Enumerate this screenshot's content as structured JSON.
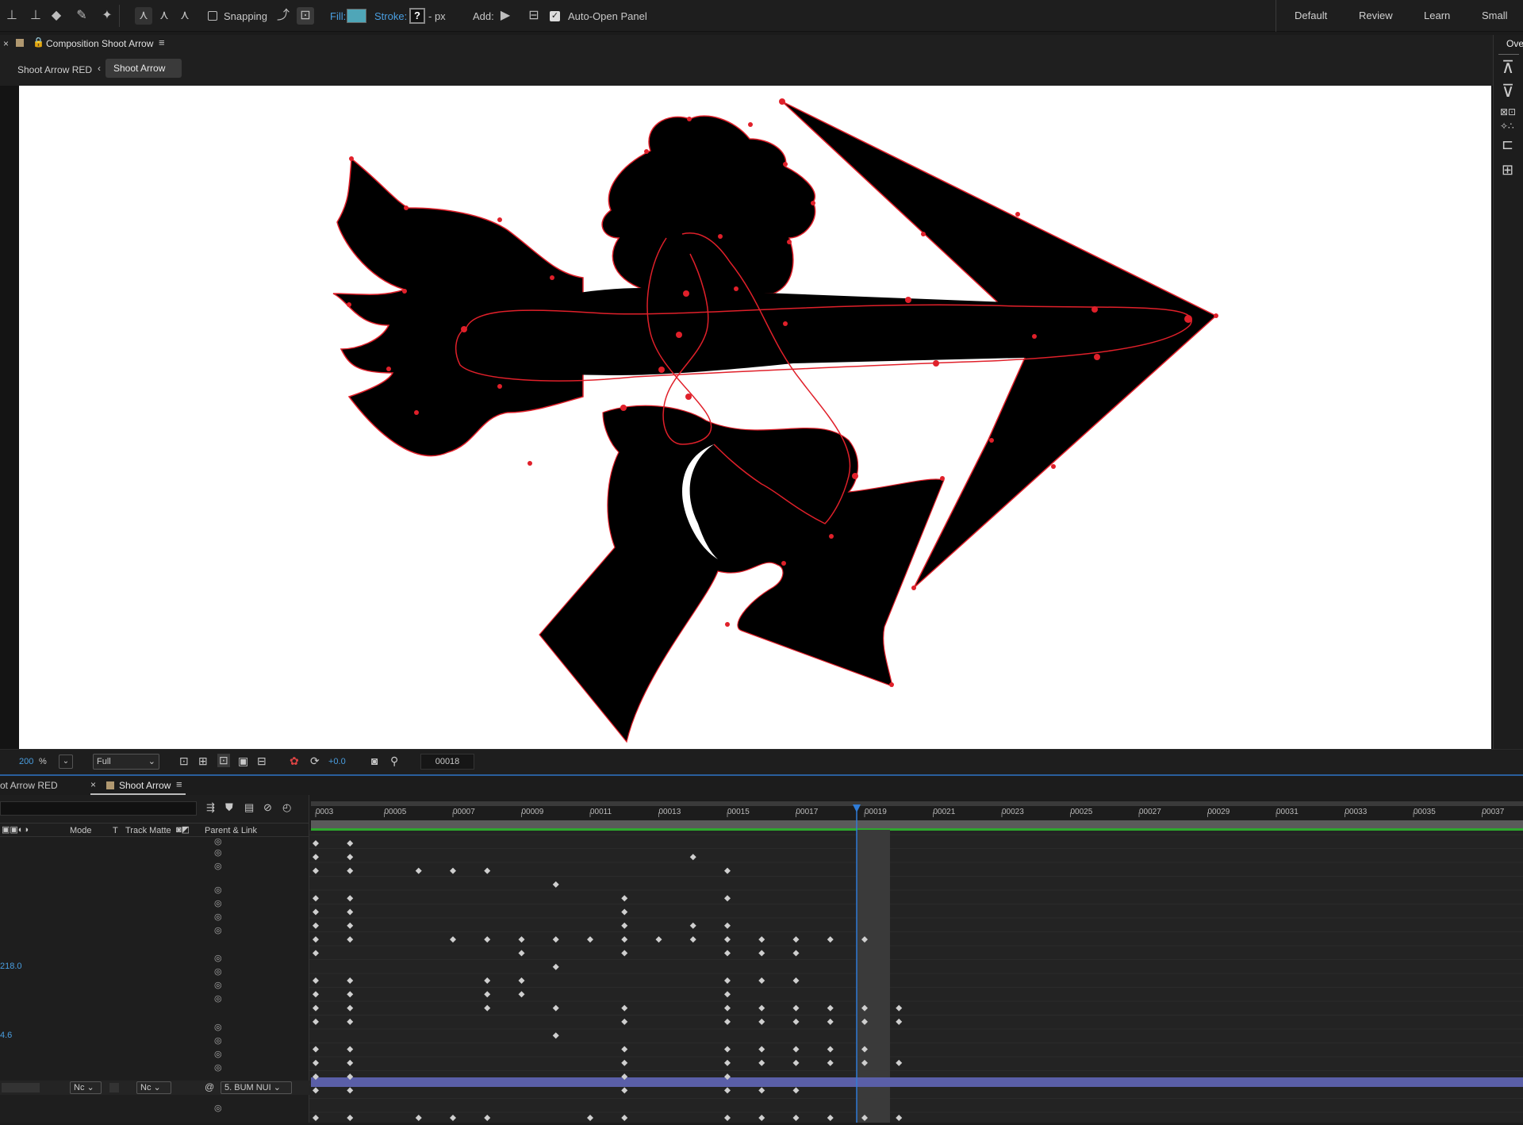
{
  "toolbar": {
    "snapping_label": "Snapping",
    "fill_label": "Fill:",
    "fill_color": "#4fa6b8",
    "stroke_label": "Stroke:",
    "stroke_value": "?",
    "stroke_unit": "- px",
    "add_label": "Add:",
    "auto_open_label": "Auto-Open Panel",
    "workspaces": [
      "Default",
      "Review",
      "Learn",
      "Small Scre"
    ]
  },
  "comp_panel": {
    "title": "Composition Shoot Arrow",
    "crumb_parent": "Shoot Arrow RED",
    "crumb_current": "Shoot Arrow",
    "right_tab": "Ove"
  },
  "viewer_footer": {
    "zoom": "200",
    "zoom_unit": "%",
    "resolution": "Full",
    "exposure": "+0.0",
    "timecode": "00018"
  },
  "timeline": {
    "tab_parent": "ot Arrow RED",
    "tab_current": "Shoot Arrow",
    "col_mode": "Mode",
    "col_t": "T",
    "col_track_matte": "Track Matte",
    "col_parent": "Parent & Link",
    "ruler_labels": [
      "0003",
      "00005",
      "00007",
      "00009",
      "00011",
      "00013",
      "00015",
      "00017",
      "00019",
      "00021",
      "00023",
      "00025",
      "00027",
      "00029",
      "00031",
      "00033",
      "00035",
      "00037"
    ],
    "current_frame_index": 8,
    "row_values": {
      "r1": "218.0",
      "r2": "4.6"
    },
    "layer": {
      "mode": "Nc",
      "matte": "Nc",
      "parent": "5. BUM NUI"
    },
    "accent_color": "#2f7bd6",
    "layer_bar_color": "#5a5fa8"
  }
}
